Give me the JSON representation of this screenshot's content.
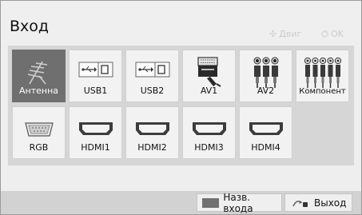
{
  "header": {
    "title": "Вход",
    "hint_move": "Двиг",
    "hint_ok": "OK"
  },
  "inputs": [
    {
      "label": "Антенна",
      "icon": "antenna-icon",
      "selected": true
    },
    {
      "label": "USB1",
      "icon": "usb-icon"
    },
    {
      "label": "USB2",
      "icon": "usb-icon"
    },
    {
      "label": "AV1",
      "icon": "scart-icon"
    },
    {
      "label": "AV2",
      "icon": "rca-av-icon"
    },
    {
      "label": "Компонент",
      "icon": "rca-component-icon"
    },
    {
      "label": "RGB",
      "icon": "vga-icon"
    },
    {
      "label": "HDMI1",
      "icon": "hdmi-icon"
    },
    {
      "label": "HDMI2",
      "icon": "hdmi-icon"
    },
    {
      "label": "HDMI3",
      "icon": "hdmi-icon"
    },
    {
      "label": "HDMI4",
      "icon": "hdmi-icon"
    }
  ],
  "footer": {
    "input_name_label": "Назв. входа",
    "exit_label": "Выход"
  },
  "colors": {
    "selected_tile": "#6f6f6f",
    "tile": "#f2f2f2",
    "panel": "#d6d6d6",
    "footer": "#d2d2d2"
  }
}
